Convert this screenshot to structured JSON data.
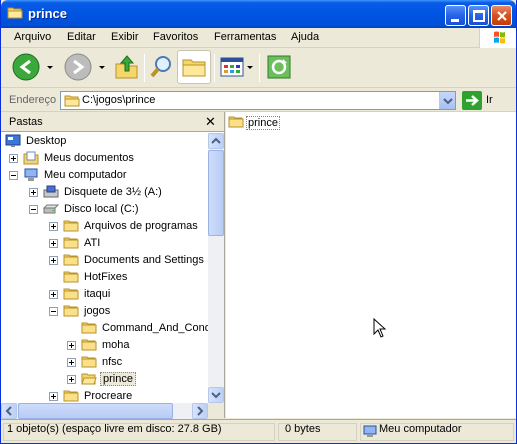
{
  "window": {
    "title": "prince"
  },
  "menu": [
    "Arquivo",
    "Editar",
    "Exibir",
    "Favoritos",
    "Ferramentas",
    "Ajuda"
  ],
  "toolbar": {
    "icons": [
      "back-arrow-icon",
      "forward-arrow-icon",
      "up-folder-icon",
      "search-icon",
      "folders-icon",
      "views-icon",
      "sync-icon"
    ]
  },
  "address": {
    "label": "Endereço",
    "path": "C:\\jogos\\prince",
    "go_label": "Ir"
  },
  "folders_pane": {
    "title": "Pastas",
    "close": "✕",
    "tree": [
      {
        "label": "Desktop",
        "icon": "desktop-icon",
        "level": 0,
        "expander": "none"
      },
      {
        "label": "Meus documentos",
        "icon": "documents-folder-icon",
        "level": 1,
        "expander": "plus"
      },
      {
        "label": "Meu computador",
        "icon": "computer-icon",
        "level": 1,
        "expander": "minus"
      },
      {
        "label": "Disquete de 3½ (A:)",
        "icon": "floppy-drive-icon",
        "level": 2,
        "expander": "plus"
      },
      {
        "label": "Disco local (C:)",
        "icon": "hard-drive-icon",
        "level": 2,
        "expander": "minus"
      },
      {
        "label": "Arquivos de programas",
        "icon": "folder-icon",
        "level": 3,
        "expander": "plus"
      },
      {
        "label": "ATI",
        "icon": "folder-icon",
        "level": 3,
        "expander": "plus"
      },
      {
        "label": "Documents and Settings",
        "icon": "folder-icon",
        "level": 3,
        "expander": "plus"
      },
      {
        "label": "HotFixes",
        "icon": "folder-icon",
        "level": 3,
        "expander": "none"
      },
      {
        "label": "itaqui",
        "icon": "folder-icon",
        "level": 3,
        "expander": "plus"
      },
      {
        "label": "jogos",
        "icon": "folder-icon",
        "level": 3,
        "expander": "minus"
      },
      {
        "label": "Command_And_Conq",
        "icon": "folder-icon",
        "level": 4,
        "expander": "none"
      },
      {
        "label": "moha",
        "icon": "folder-icon",
        "level": 4,
        "expander": "plus"
      },
      {
        "label": "nfsc",
        "icon": "folder-icon",
        "level": 4,
        "expander": "plus"
      },
      {
        "label": "prince",
        "icon": "folder-open-icon",
        "level": 4,
        "expander": "plus",
        "selected": true
      },
      {
        "label": "Procreare",
        "icon": "folder-icon",
        "level": 3,
        "expander": "plus"
      }
    ]
  },
  "content": {
    "items": [
      {
        "label": "prince",
        "icon": "folder-icon"
      }
    ]
  },
  "statusbar": {
    "objects": "1 objeto(s) (espaço livre em disco:  27.8 GB)",
    "size": "0 bytes",
    "location": "Meu computador"
  },
  "colors": {
    "titlebar": "#0054e3",
    "folder": "#f5d66b",
    "chrome": "#ece9d8"
  }
}
